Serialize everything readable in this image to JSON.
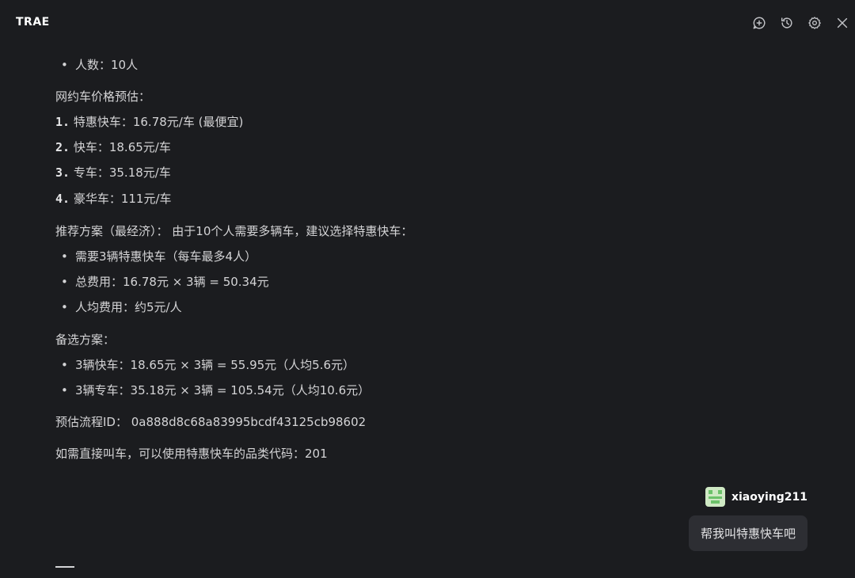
{
  "app": {
    "title": "TRAE"
  },
  "toolbar": {
    "new_chat_icon": "new-chat-icon",
    "history_icon": "history-icon",
    "settings_icon": "gear-icon",
    "close_icon": "close-icon"
  },
  "message": {
    "people_bullet": "人数：10人",
    "price_heading": "网约车价格预估：",
    "prices": [
      {
        "num": "1.",
        "text": "特惠快车：16.78元/车 (最便宜)"
      },
      {
        "num": "2.",
        "text": "快车：18.65元/车"
      },
      {
        "num": "3.",
        "text": "专车：35.18元/车"
      },
      {
        "num": "4.",
        "text": "豪华车：111元/车"
      }
    ],
    "recommend_heading": "推荐方案（最经济）： 由于10个人需要多辆车，建议选择特惠快车：",
    "recommend_items": [
      "需要3辆特惠快车（每车最多4人）",
      "总费用：16.78元 × 3辆 = 50.34元",
      "人均费用：约5元/人"
    ],
    "alt_heading": "备选方案：",
    "alt_items": [
      "3辆快车：18.65元 × 3辆 = 55.95元（人均5.6元）",
      "3辆专车：35.18元 × 3辆 = 105.54元（人均10.6元）"
    ],
    "flow_id": "预估流程ID： 0a888d8c68a83995bcdf43125cb98602",
    "category_code": "如需直接叫车，可以使用特惠快车的品类代码：201"
  },
  "user": {
    "name": "xiaoying211",
    "message": "帮我叫特惠快车吧"
  },
  "colors": {
    "background": "#1b1c1f",
    "bubble": "#2d2e33",
    "text": "#d4d4d6"
  }
}
